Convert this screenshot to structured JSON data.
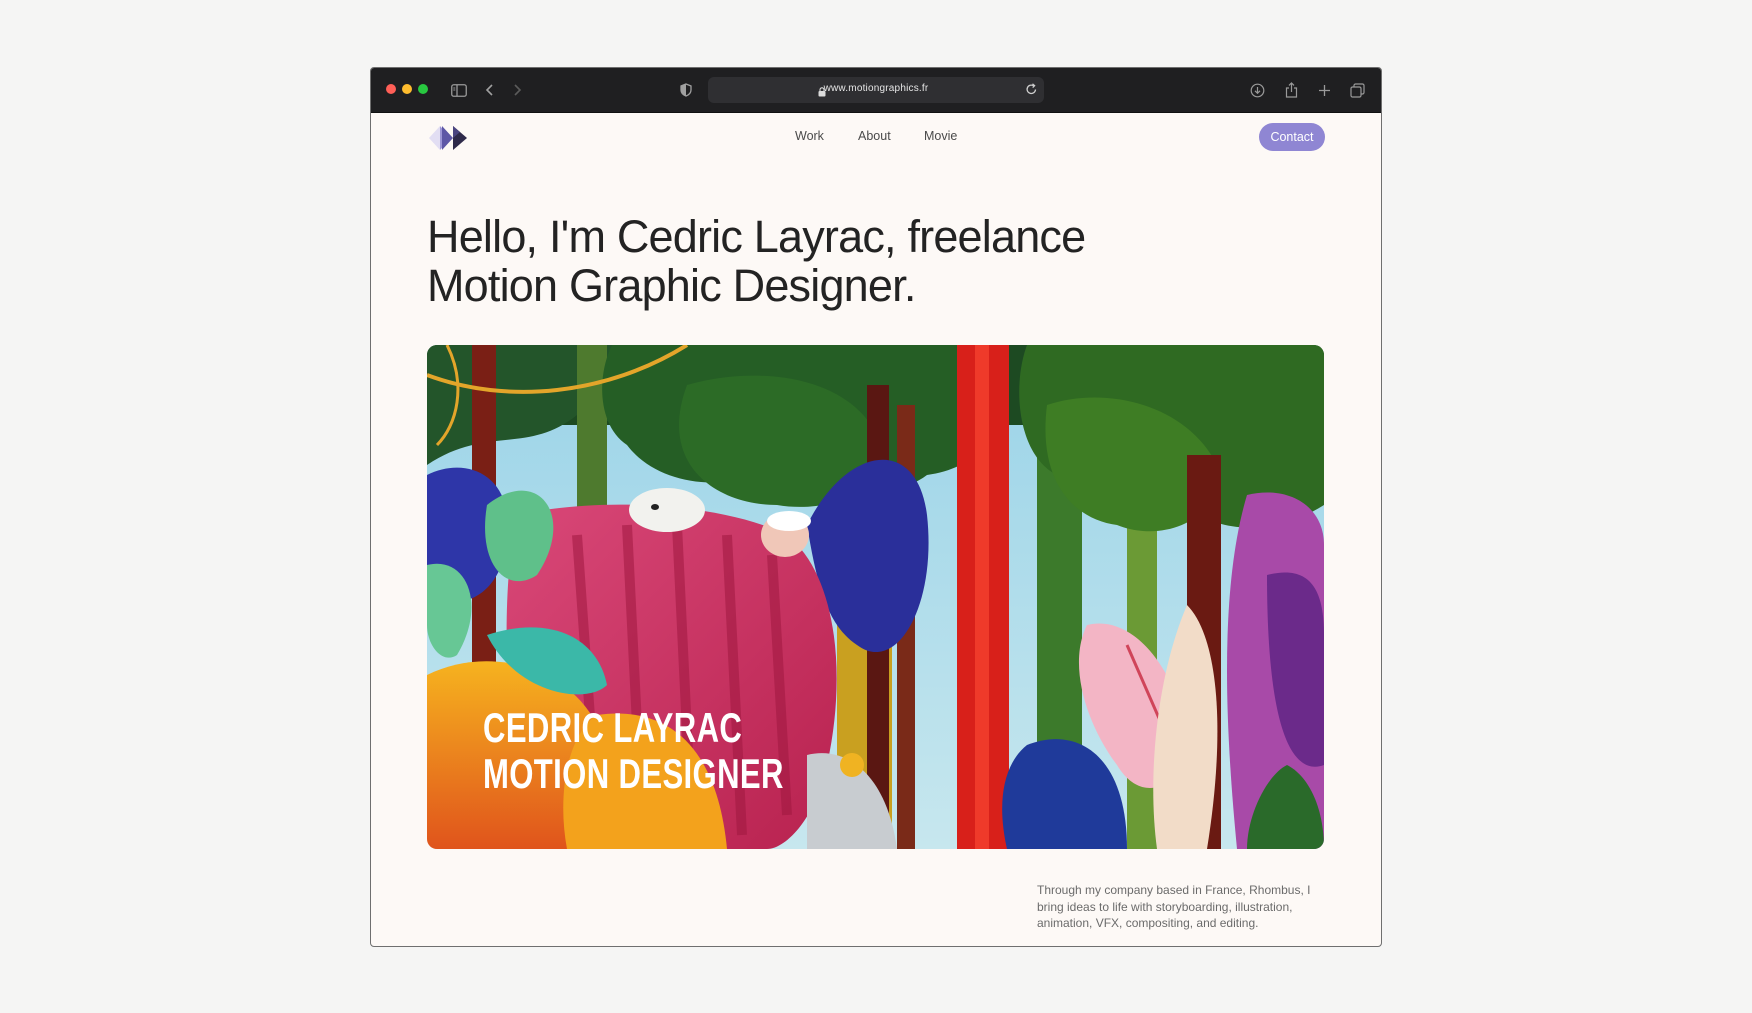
{
  "browser": {
    "url": "www.motiongraphics.fr",
    "traffic_lights": {
      "close": "#ff5f57",
      "minimize": "#febc2e",
      "zoom": "#28c840"
    },
    "icons": [
      "sidebar-icon",
      "back-icon",
      "forward-icon",
      "shield-icon",
      "lock-icon",
      "reload-icon",
      "download-icon",
      "share-icon",
      "new-tab-icon",
      "tabs-overview-icon"
    ]
  },
  "site": {
    "nav": {
      "work": "Work",
      "about": "About",
      "movie": "Movie"
    },
    "contact_label": "Contact",
    "accent_color": "#8f86d3",
    "headline": "Hello, I'm Cedric Layrac, freelance Motion Graphic Designer.",
    "hero": {
      "line1": "CEDRIC LAYRAC",
      "line2": "MOTION DESIGNER"
    },
    "intro": "Through my company based in France, Rhombus, I bring ideas to life with storyboarding, illustration, animation, VFX, compositing, and editing."
  }
}
